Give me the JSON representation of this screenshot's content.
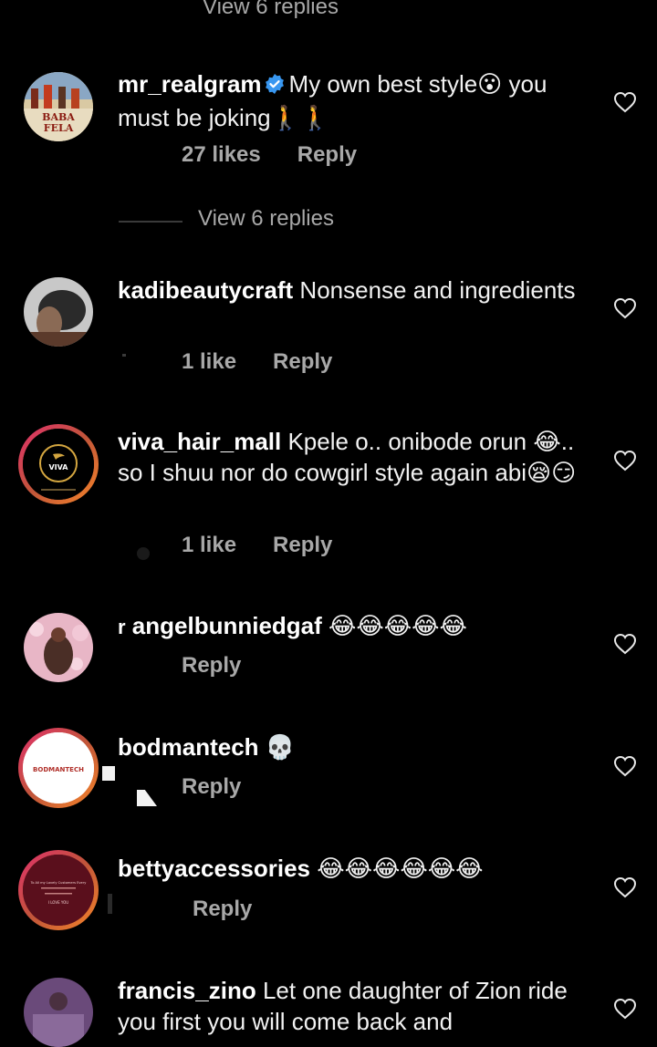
{
  "top_partial_text": "View 6 replies",
  "comments": [
    {
      "username": "mr_realgram",
      "verified": true,
      "text": "My own best style😮 you must be joking🚶🚶",
      "likes": "27 likes",
      "reply": "Reply",
      "avatar_text_1": "BABA",
      "avatar_text_2": "FELA"
    },
    {
      "username": "kadibeautycraft",
      "text": "Nonsense and ingredients",
      "likes": "1 like",
      "reply": "Reply"
    },
    {
      "username": "viva_hair_mall",
      "text": "Kpele o.. onibode orun 😂.. so I shuu nor do cowgirl style again abi😪😏",
      "likes": "1 like",
      "reply": "Reply",
      "avatar_text": "VIVA"
    },
    {
      "username": "angelbunniedgaf",
      "username_prefix": "r",
      "text": "😂😂😂😂😂",
      "reply": "Reply"
    },
    {
      "username": "bodmantech",
      "text": "💀",
      "reply": "Reply",
      "avatar_text": "BODMANTECH"
    },
    {
      "username": "bettyaccessories",
      "text": "😂😂😂😂😂😂",
      "reply": "Reply",
      "avatar_text_1": "To All my Lovely Customers Every",
      "avatar_text_2": "I LOVE YOU"
    },
    {
      "username": "francis_zino",
      "text": "Let one daughter of Zion ride you first you will come back and"
    }
  ],
  "view_replies": "View 6 replies",
  "colors": {
    "background": "#000000",
    "text_primary": "#f2f2f2",
    "text_secondary": "#a8a8a8",
    "verified_blue": "#3897f0",
    "story_ring_start": "#e1306c",
    "story_ring_end": "#f58529"
  },
  "icons": [
    "verified-badge-icon",
    "heart-icon"
  ]
}
